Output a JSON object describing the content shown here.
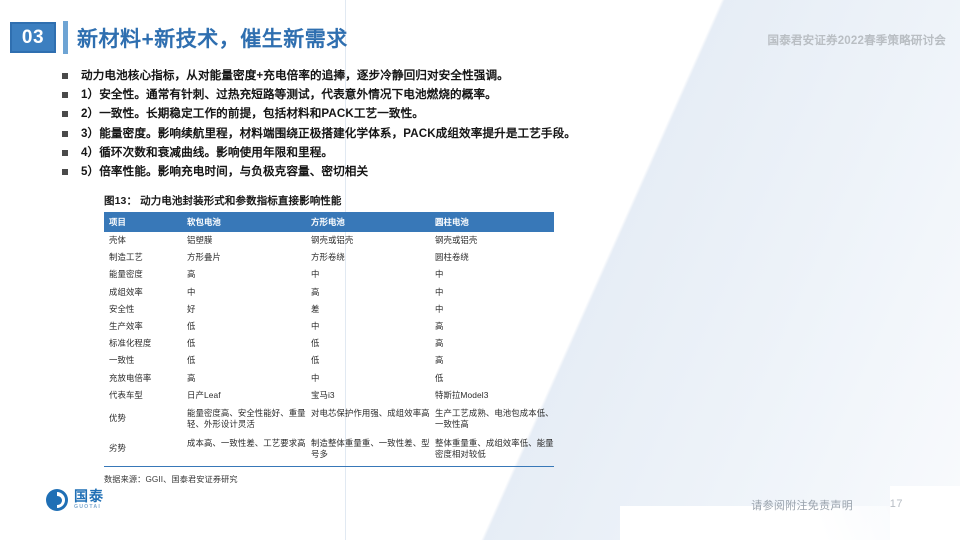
{
  "header": {
    "section_number": "03",
    "title": "新材料+新技术，催生新需求",
    "conference": "国泰君安证券2022春季策略研讨会"
  },
  "bullets": [
    "动力电池核心指标，从对能量密度+充电倍率的追捧，逐步冷静回归对安全性强调。",
    "1）安全性。通常有针刺、过热充短路等测试，代表意外情况下电池燃烧的概率。",
    "2）一致性。长期稳定工作的前提，包括材料和PACK工艺一致性。",
    "3）能量密度。影响续航里程，材料端围绕正极搭建化学体系，PACK成组效率提升是工艺手段。",
    "4）循环次数和衰减曲线。影响使用年限和里程。",
    "5）倍率性能。影响充电时间，与负极克容量、密切相关"
  ],
  "figure": {
    "title": "图13： 动力电池封装形式和参数指标直接影响性能",
    "source": "数据来源：GGII、国泰君安证券研究",
    "header_color": "#3878b8",
    "columns": [
      "项目",
      "软包电池",
      "方形电池",
      "圆柱电池"
    ],
    "rows": [
      {
        "label": "壳体",
        "cells": [
          "铝塑膜",
          "钢壳或铝壳",
          "钢壳或铝壳"
        ]
      },
      {
        "label": "制造工艺",
        "cells": [
          "方形叠片",
          "方形卷绕",
          "圆柱卷绕"
        ]
      },
      {
        "label": "能量密度",
        "cells": [
          "高",
          "中",
          "中"
        ]
      },
      {
        "label": "成组效率",
        "cells": [
          "中",
          "高",
          "中"
        ]
      },
      {
        "label": "安全性",
        "cells": [
          "好",
          "差",
          "中"
        ]
      },
      {
        "label": "生产效率",
        "cells": [
          "低",
          "中",
          "高"
        ]
      },
      {
        "label": "标准化程度",
        "cells": [
          "低",
          "低",
          "高"
        ]
      },
      {
        "label": "一致性",
        "cells": [
          "低",
          "低",
          "高"
        ]
      },
      {
        "label": "充放电倍率",
        "cells": [
          "高",
          "中",
          "低"
        ]
      },
      {
        "label": "代表车型",
        "cells": [
          "日产Leaf",
          "宝马i3",
          "特斯拉Model3"
        ]
      },
      {
        "label": "优势",
        "cells": [
          "能量密度高、安全性能好、重量轻、外形设计灵活",
          "对电芯保护作用强、成组效率高",
          "生产工艺成熟、电池包成本低、一致性高"
        ]
      },
      {
        "label": "劣势",
        "cells": [
          "成本高、一致性差、工艺要求高",
          "制造整体重量重、一致性差、型号多",
          "整体重量重、成组效率低、能量密度相对较低"
        ]
      }
    ]
  },
  "logo": {
    "cn": "国泰",
    "en": "GUOTAI"
  },
  "footer": {
    "disclaimer": "请参阅附注免责声明",
    "page_number": "17"
  }
}
